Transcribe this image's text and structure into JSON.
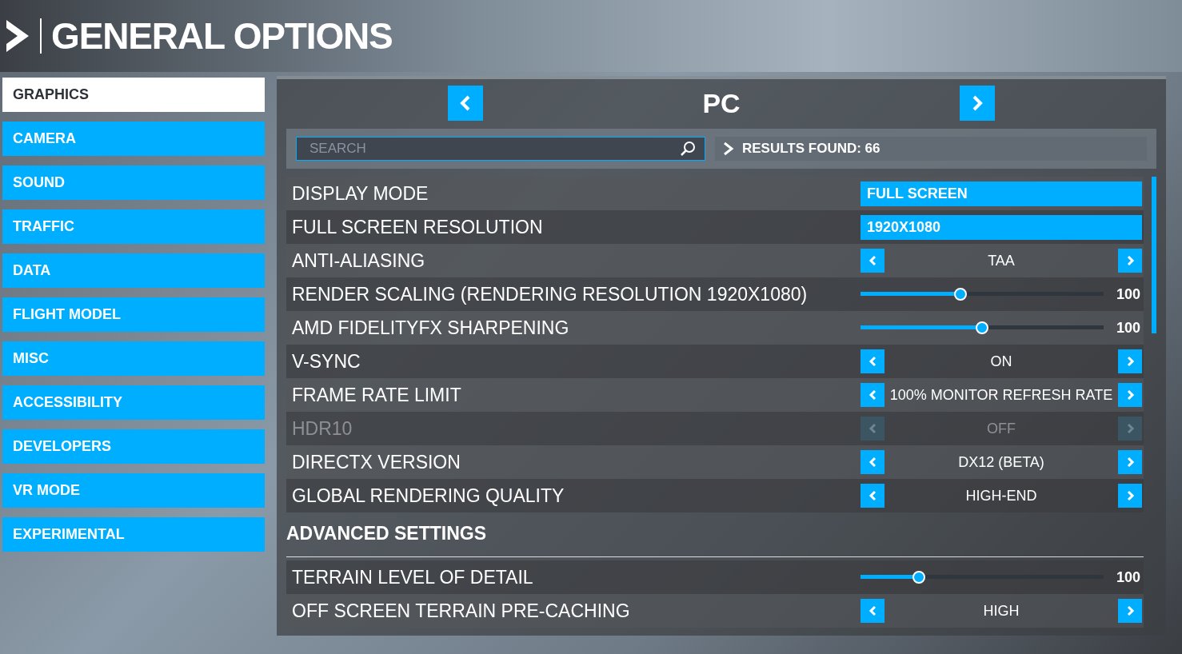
{
  "header": {
    "title": "GENERAL OPTIONS"
  },
  "sidebar": {
    "items": [
      {
        "label": "GRAPHICS",
        "selected": true
      },
      {
        "label": "CAMERA",
        "selected": false
      },
      {
        "label": "SOUND",
        "selected": false
      },
      {
        "label": "TRAFFIC",
        "selected": false
      },
      {
        "label": "DATA",
        "selected": false
      },
      {
        "label": "FLIGHT MODEL",
        "selected": false
      },
      {
        "label": "MISC",
        "selected": false
      },
      {
        "label": "ACCESSIBILITY",
        "selected": false
      },
      {
        "label": "DEVELOPERS",
        "selected": false
      },
      {
        "label": "VR MODE",
        "selected": false
      },
      {
        "label": "EXPERIMENTAL",
        "selected": false
      }
    ]
  },
  "profile": {
    "title": "PC"
  },
  "search": {
    "placeholder": "SEARCH"
  },
  "results": "RESULTS FOUND: 66",
  "settings": [
    {
      "kind": "dropdown",
      "label": "DISPLAY MODE",
      "value": "FULL SCREEN",
      "disabled": false
    },
    {
      "kind": "dropdown",
      "label": "FULL SCREEN RESOLUTION",
      "value": "1920X1080",
      "disabled": false
    },
    {
      "kind": "selector",
      "label": "ANTI-ALIASING",
      "value": "TAA",
      "disabled": false
    },
    {
      "kind": "slider",
      "label": "RENDER SCALING (RENDERING RESOLUTION 1920X1080)",
      "level": 0.41,
      "value": "100",
      "disabled": false
    },
    {
      "kind": "slider",
      "label": "AMD FIDELITYFX SHARPENING",
      "level": 0.5,
      "value": "100",
      "disabled": false
    },
    {
      "kind": "selector",
      "label": "V-SYNC",
      "value": "ON",
      "disabled": false
    },
    {
      "kind": "selector",
      "label": "FRAME RATE LIMIT",
      "value": "100% MONITOR REFRESH RATE",
      "disabled": false
    },
    {
      "kind": "selector",
      "label": "HDR10",
      "value": "OFF",
      "disabled": true
    },
    {
      "kind": "selector",
      "label": "DIRECTX VERSION",
      "value": "DX12 (BETA)",
      "disabled": false
    },
    {
      "kind": "selector",
      "label": "GLOBAL RENDERING QUALITY",
      "value": "HIGH-END",
      "disabled": false
    },
    {
      "kind": "heading",
      "label": "ADVANCED SETTINGS"
    },
    {
      "kind": "slider",
      "label": "TERRAIN LEVEL OF DETAIL",
      "level": 0.24,
      "value": "100",
      "disabled": false
    },
    {
      "kind": "selector",
      "label": "OFF SCREEN TERRAIN PRE-CACHING",
      "value": "HIGH",
      "disabled": false
    }
  ]
}
